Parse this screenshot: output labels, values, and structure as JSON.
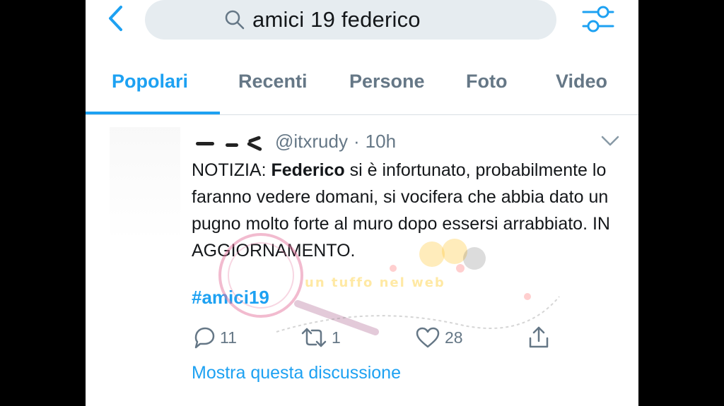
{
  "header": {
    "search_query": "amici 19 federico"
  },
  "tabs": [
    {
      "label": "Popolari",
      "active": true
    },
    {
      "label": "Recenti",
      "active": false
    },
    {
      "label": "Persone",
      "active": false
    },
    {
      "label": "Foto",
      "active": false
    },
    {
      "label": "Video",
      "active": false
    }
  ],
  "tweet": {
    "handle": "@itxrudy",
    "separator": "·",
    "time": "10h",
    "text_prefix": "NOTIZIA: ",
    "text_bold": "Federico",
    "text_rest": " si è infortunato, probabilmente lo faranno vedere domani, si vocifera che abbia dato un pugno molto forte al muro dopo essersi arrabbiato. IN AGGIORNAMENTO.",
    "hashtag": "#amici19",
    "replies": "11",
    "retweets": "1",
    "likes": "28",
    "show_thread": "Mostra questa discussione"
  },
  "watermark": {
    "text": "un tuffo nel web"
  },
  "colors": {
    "accent": "#1da1f2",
    "secondary_text": "#657786",
    "search_bg": "#e6ecf0"
  },
  "icons": [
    "back-chevron-icon",
    "search-icon",
    "filter-sliders-icon",
    "chevron-down-icon",
    "reply-icon",
    "retweet-icon",
    "like-icon",
    "share-icon"
  ]
}
